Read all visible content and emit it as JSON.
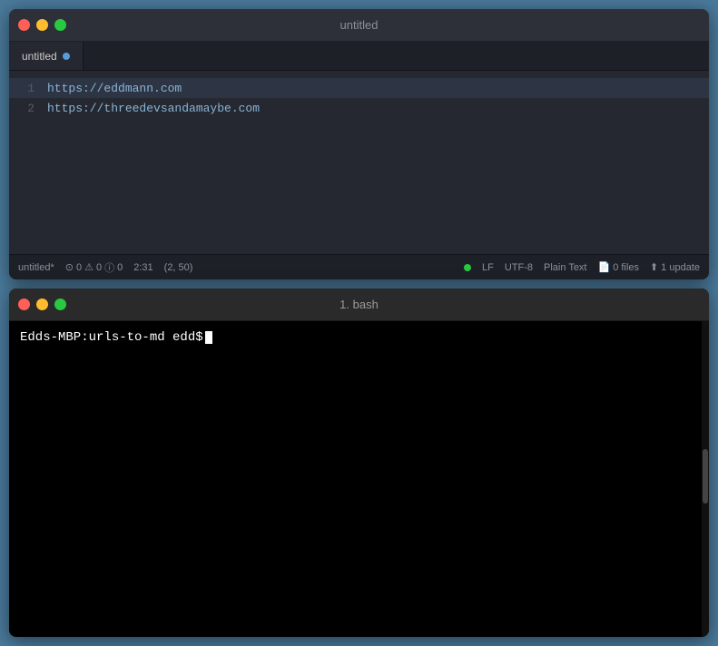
{
  "editor": {
    "window_title": "untitled",
    "tab_label": "untitled",
    "lines": [
      {
        "number": "1",
        "content": "https://eddmann.com"
      },
      {
        "number": "2",
        "content": "https://threedevsandamaybe.com"
      }
    ],
    "status": {
      "filename": "untitled*",
      "errors": "0",
      "warnings": "0",
      "info": "0",
      "time": "2:31",
      "position": "(2, 50)",
      "encoding": "LF",
      "charset": "UTF-8",
      "syntax": "Plain Text",
      "files": "0 files",
      "update": "1 update"
    }
  },
  "terminal": {
    "title": "1. bash",
    "prompt": "Edds-MBP:urls-to-md edd$ "
  }
}
